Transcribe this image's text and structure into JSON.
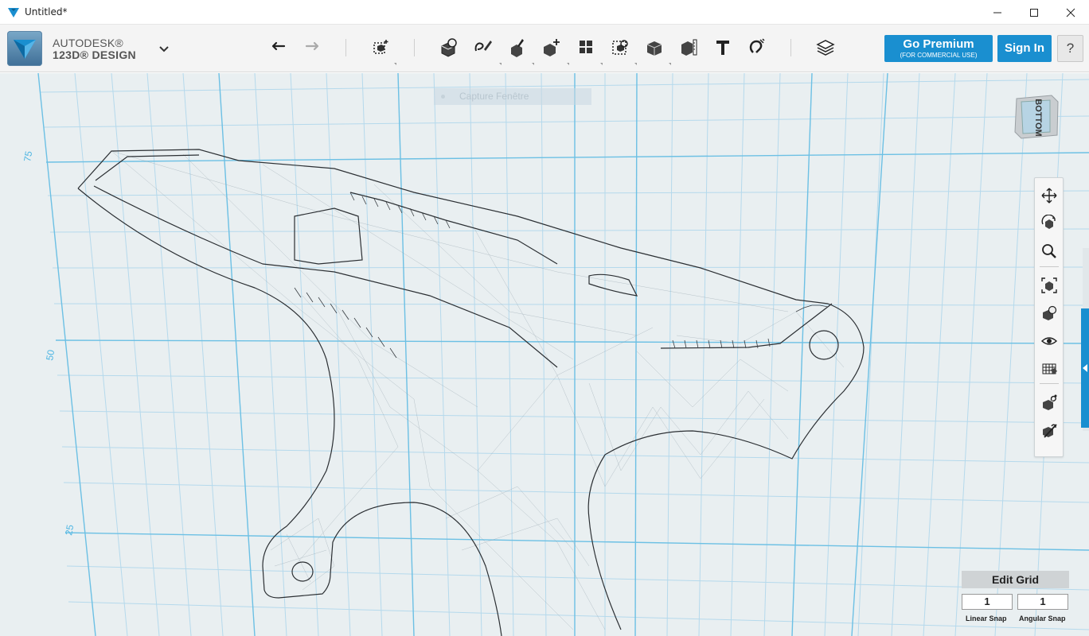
{
  "window": {
    "title": "Untitled*",
    "controls": {
      "minimize": "minimize-icon",
      "maximize": "maximize-icon",
      "close": "close-icon"
    }
  },
  "brand": {
    "line1": "AUTODESK®",
    "line2": "123D® DESIGN",
    "menu_icon": "chevron-down-icon"
  },
  "toolbar": {
    "tools": [
      {
        "name": "undo",
        "icon": "undo-icon"
      },
      {
        "name": "redo",
        "icon": "redo-icon"
      },
      {
        "name": "transform",
        "icon": "transform-icon"
      },
      {
        "name": "primitives",
        "icon": "primitives-icon"
      },
      {
        "name": "sketch",
        "icon": "sketch-icon"
      },
      {
        "name": "construct",
        "icon": "construct-icon"
      },
      {
        "name": "modify",
        "icon": "modify-icon"
      },
      {
        "name": "pattern",
        "icon": "pattern-icon"
      },
      {
        "name": "grouping",
        "icon": "grouping-icon"
      },
      {
        "name": "combine",
        "icon": "combine-icon"
      },
      {
        "name": "measure",
        "icon": "measure-icon"
      },
      {
        "name": "text",
        "icon": "text-icon"
      },
      {
        "name": "snap",
        "icon": "snap-icon"
      },
      {
        "name": "materials",
        "icon": "materials-icon"
      }
    ]
  },
  "account": {
    "premium_label": "Go Premium",
    "premium_sub": "(FOR COMMERCIAL USE)",
    "signin_label": "Sign In",
    "help_label": "?"
  },
  "viewport": {
    "overlay_label": "Capture Fenêtre",
    "viewcube_face": "BOTTOM",
    "axis_labels": [
      "75",
      "50",
      "25"
    ]
  },
  "nav_panel": {
    "tools": [
      "pan-icon",
      "orbit-icon",
      "zoom-icon",
      "fit-icon",
      "views-icon",
      "visibility-icon",
      "grid-mesh-icon",
      "material-display-icon",
      "outline-display-icon"
    ]
  },
  "grid_controls": {
    "edit_grid_label": "Edit Grid",
    "linear_snap_value": "1",
    "angular_snap_value": "1",
    "linear_snap_label": "Linear Snap",
    "angular_snap_label": "Angular Snap"
  },
  "colors": {
    "accent": "#1a8fd0",
    "grid_major": "#6cc0e4",
    "grid_minor": "#a8d4ea",
    "viewport_bg": "#e9eff1"
  }
}
